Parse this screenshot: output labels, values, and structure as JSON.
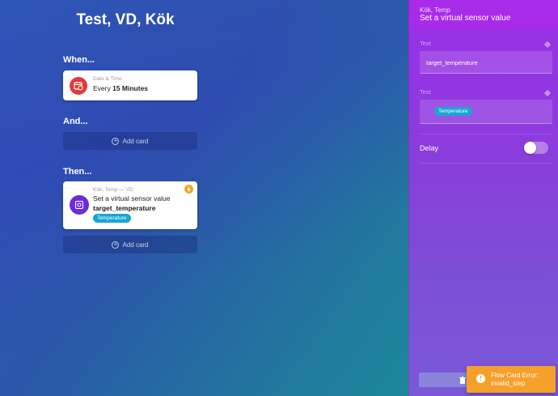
{
  "flow": {
    "title": "Test, VD, Kök"
  },
  "sections": {
    "when": "When...",
    "and": "And...",
    "then": "Then..."
  },
  "when_card": {
    "icon": "calendar-clock-icon",
    "subtitle": "Date & Time",
    "line_prefix": "Every",
    "line_value": "15 Minutes"
  },
  "add_card_label": "Add card",
  "then_card": {
    "icon": "virtual-device-icon",
    "subtitle": "Kök, Temp — VD",
    "line1": "Set a virtual sensor value",
    "line2": "target_temperature",
    "tag": "Temperature"
  },
  "panel": {
    "subtitle": "Kök, Temp",
    "title": "Set a virtual sensor value",
    "field1": {
      "label": "Text",
      "value": "target_temperature"
    },
    "field2": {
      "label": "Text",
      "tag": "Temperature"
    },
    "delay_label": "Delay",
    "delay_on": false
  },
  "colors": {
    "when_icon_bg": "#e03a3a",
    "then_icon_bg": "#6a2cd8",
    "tag_bg": "#19a6d4",
    "toast_bg": "#f6a02c",
    "panel_bg": "#9c2fe8"
  },
  "toast": {
    "line1": "Flow Card Error:",
    "line2": "invalid_step"
  }
}
